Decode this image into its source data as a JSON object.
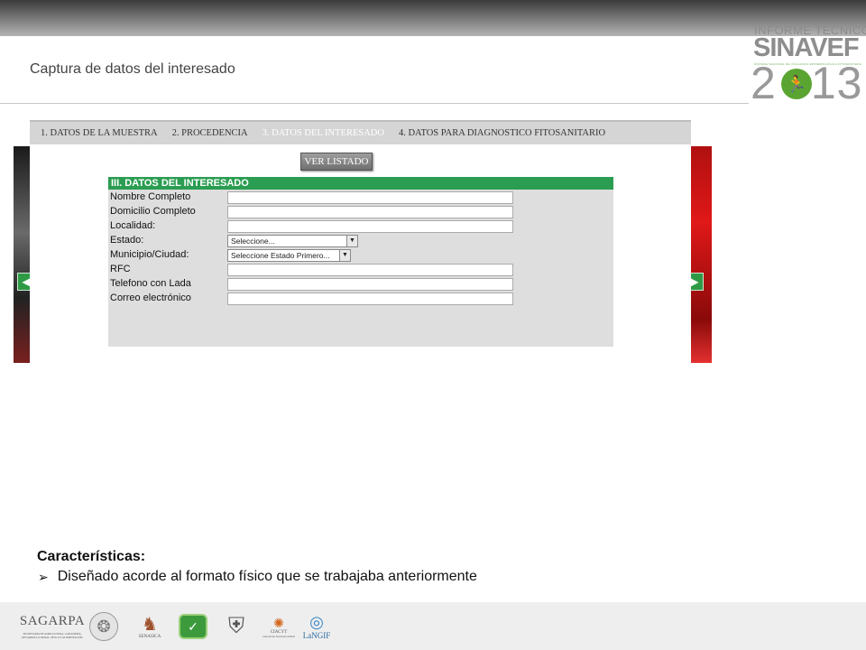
{
  "slide": {
    "title": "Captura de datos del interesado",
    "brand": {
      "top": "INFORME TECNICO",
      "name": "SINAVEF",
      "subline": "SISTEMA NACIONAL DE VIGILANCIA EPIDEMIOLÓGICA FITOSANITARIA",
      "year_left": "2",
      "year_right": "13"
    }
  },
  "app": {
    "tabs": [
      {
        "label": "1. DATOS DE LA MUESTRA"
      },
      {
        "label": "2. PROCEDENCIA"
      },
      {
        "label": "3. DATOS DEL INTERESADO"
      },
      {
        "label": "4. DATOS PARA DIAGNOSTICO FITOSANITARIO"
      }
    ],
    "list_button": "VER LISTADO",
    "form": {
      "heading": "III. DATOS DEL INTERESADO",
      "fields": [
        {
          "label": "Nombre Completo",
          "value": ""
        },
        {
          "label": "Domicilio Completo",
          "value": ""
        },
        {
          "label": "Localidad:",
          "value": ""
        },
        {
          "label": "Estado:",
          "selected": "Seleccione..."
        },
        {
          "label": "Municipio/Ciudad:",
          "selected": "Seleccione Estado Primero..."
        },
        {
          "label": "RFC",
          "value": ""
        },
        {
          "label": "Telefono con Lada",
          "value": ""
        },
        {
          "label": "Correo electrónico",
          "value": ""
        }
      ]
    }
  },
  "features": {
    "heading": "Características:",
    "items": [
      "Diseñado acorde al formato físico que se trabajaba anteriormente"
    ]
  },
  "footer": {
    "logos": {
      "sagarpa": "SAGARPA",
      "sagarpa_sub": "SECRETARÍA DE AGRICULTURA, GANADERÍA, DESARROLLO RURAL, PESCA Y ALIMENTACIÓN",
      "senasica": "SENASICA",
      "ciacyt": "CIACYT",
      "ciacyt_sub": "Laboratorio Nacional UASLP",
      "langif": "LaNGIF"
    }
  },
  "colors": {
    "form_header": "#2b9d52",
    "form_bg": "#dedede",
    "tabbar": "#d5d5d5",
    "nav_arrow": "#2e9a45",
    "brand_green": "#5aa532",
    "right_photo": "#d01414"
  },
  "icons": {
    "prev": "triangle-left",
    "next": "triangle-right",
    "bullet": "arrowhead-bullet",
    "dropdown": "chevron-down"
  }
}
